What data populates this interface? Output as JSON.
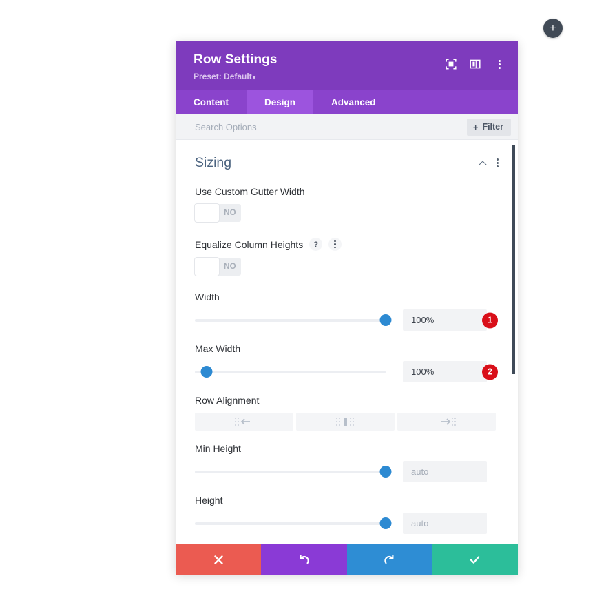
{
  "fab": {
    "icon": "plus-icon",
    "label": "+"
  },
  "header": {
    "title": "Row Settings",
    "preset_label": "Preset: Default",
    "caret": "▾",
    "icons": [
      "focus-target-icon",
      "layout-panel-icon",
      "more-options-icon"
    ]
  },
  "tabs": [
    {
      "label": "Content",
      "active": false
    },
    {
      "label": "Design",
      "active": true
    },
    {
      "label": "Advanced",
      "active": false
    }
  ],
  "search": {
    "placeholder": "Search Options",
    "value": "",
    "filter_label": "Filter",
    "filter_plus": "+"
  },
  "section": {
    "title": "Sizing",
    "collapse_icon": "chevron-up-icon",
    "more_icon": "more-options-icon"
  },
  "fields": {
    "gutter": {
      "label": "Use Custom Gutter Width",
      "toggle_state": "NO"
    },
    "equalize": {
      "label": "Equalize Column Heights",
      "help_icon": "?",
      "more_icon": "more-options-icon",
      "toggle_state": "NO"
    },
    "width": {
      "label": "Width",
      "value": "100%",
      "slider_percent": 100,
      "badge": "1"
    },
    "max_width": {
      "label": "Max Width",
      "value": "100%",
      "slider_percent": 6,
      "badge": "2"
    },
    "row_alignment": {
      "label": "Row Alignment",
      "options": [
        "align-left-icon",
        "align-center-icon",
        "align-right-icon"
      ]
    },
    "min_height": {
      "label": "Min Height",
      "placeholder": "auto",
      "value": "",
      "slider_percent": 100
    },
    "height": {
      "label": "Height",
      "placeholder": "auto",
      "value": "",
      "slider_percent": 100
    }
  },
  "footer": {
    "cancel": {
      "icon": "close-icon",
      "glyph": "✖"
    },
    "undo": {
      "icon": "undo-icon",
      "glyph": "↺"
    },
    "redo": {
      "icon": "redo-icon",
      "glyph": "↻"
    },
    "save": {
      "icon": "check-icon",
      "glyph": "✔"
    }
  },
  "colors": {
    "header_purple": "#7e3bbd",
    "tab_bar_purple": "#8a43cc",
    "tab_active_purple": "#9c54de",
    "slider_blue": "#2d8ad2",
    "badge_red": "#d90f19",
    "cancel_red": "#eb5b51",
    "undo_purple": "#8a3ad6",
    "redo_blue": "#2e8dd4",
    "save_green": "#2cbe9a"
  }
}
